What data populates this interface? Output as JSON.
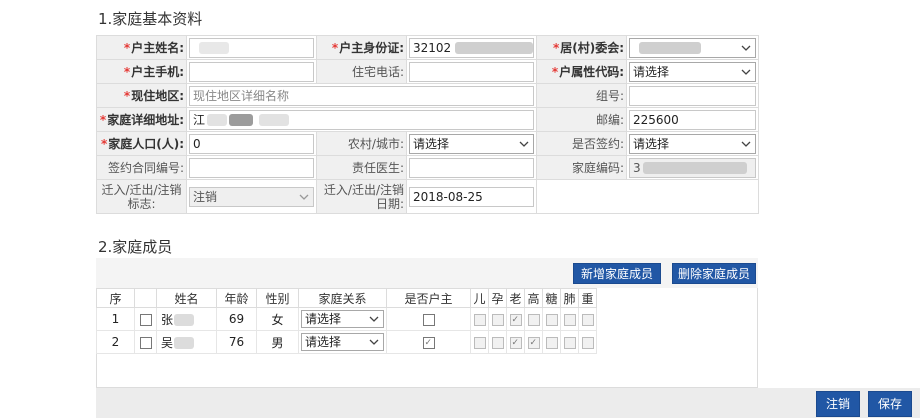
{
  "sections": {
    "basic_title": "1.家庭基本资料",
    "members_title": "2.家庭成员"
  },
  "form": {
    "head_name_label": "户主姓名:",
    "head_id_label": "户主身份证:",
    "head_id_value": "32102",
    "committee_label": "居(村)委会:",
    "head_phone_label": "户主手机:",
    "home_phone_label": "住宅电话:",
    "household_type_label": "户属性代码:",
    "household_type_value": "请选择",
    "current_area_label": "现住地区:",
    "current_area_placeholder": "现住地区详细名称",
    "group_label": "组号:",
    "detail_address_label": "家庭详细地址:",
    "detail_address_value": "江",
    "postcode_label": "邮编:",
    "postcode_value": "225600",
    "population_label": "家庭人口(人):",
    "population_value": "0",
    "rural_urban_label": "农村/城市:",
    "rural_urban_value": "请选择",
    "signed_label": "是否签约:",
    "signed_value": "请选择",
    "contract_no_label": "签约合同编号:",
    "doctor_label": "责任医生:",
    "family_code_label": "家庭编码:",
    "family_code_value": "3",
    "migrate_flag_label": "迁入/迁出/注销标志:",
    "migrate_flag_value": "注销",
    "migrate_date_label": "迁入/迁出/注销日期:",
    "migrate_date_value": "2018-08-25"
  },
  "members": {
    "add_button": "新增家庭成员",
    "delete_button": "删除家庭成员",
    "columns": [
      "序",
      "",
      "姓名",
      "年龄",
      "性别",
      "家庭关系",
      "是否户主",
      "儿",
      "孕",
      "老",
      "高",
      "糖",
      "肺",
      "重"
    ],
    "rows": [
      {
        "seq": "1",
        "name": "张",
        "age": "69",
        "sex": "女",
        "relation": "请选择",
        "is_head": false,
        "flags": [
          false,
          false,
          true,
          false,
          false,
          false,
          false
        ]
      },
      {
        "seq": "2",
        "name": "吴",
        "age": "76",
        "sex": "男",
        "relation": "请选择",
        "is_head": true,
        "flags": [
          false,
          false,
          true,
          true,
          false,
          false,
          false
        ]
      }
    ]
  },
  "footer": {
    "cancel_button": "注销",
    "save_button": "保存"
  },
  "colors": {
    "primary_button": "#2157a5",
    "required_star": "#e53935",
    "label_bg": "#f0f0f0"
  }
}
